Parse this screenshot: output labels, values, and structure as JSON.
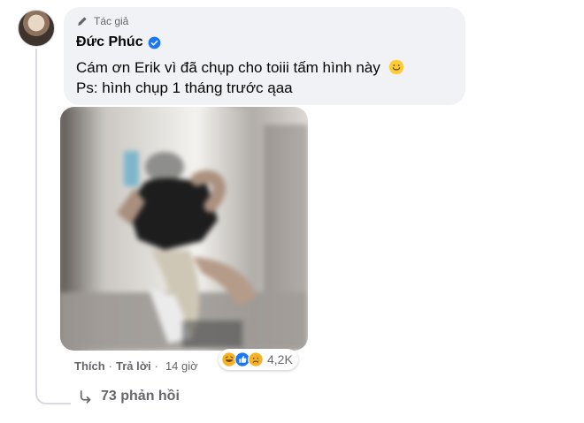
{
  "comment": {
    "author_tag": "Tác giả",
    "author_name": "Đức Phúc",
    "text_line_1": "Cám ơn Erik vì đã chụp cho toiii tấm hình này",
    "text_line_2": "Ps: hình chụp 1 tháng trước ąaa",
    "emoji": "slightly-smiling-face"
  },
  "actions": {
    "like": "Thích",
    "separator": "·",
    "reply": "Trả lời",
    "time": "14 giờ"
  },
  "reactions": {
    "icons": [
      "haha-icon",
      "like-icon",
      "sad-icon"
    ],
    "count": "4,2K"
  },
  "replies": {
    "label": "73 phản hồi"
  },
  "colors": {
    "bubble": "#f0f2f5",
    "text": "#050505",
    "secondary": "#65676b",
    "accent": "#1877f2"
  }
}
